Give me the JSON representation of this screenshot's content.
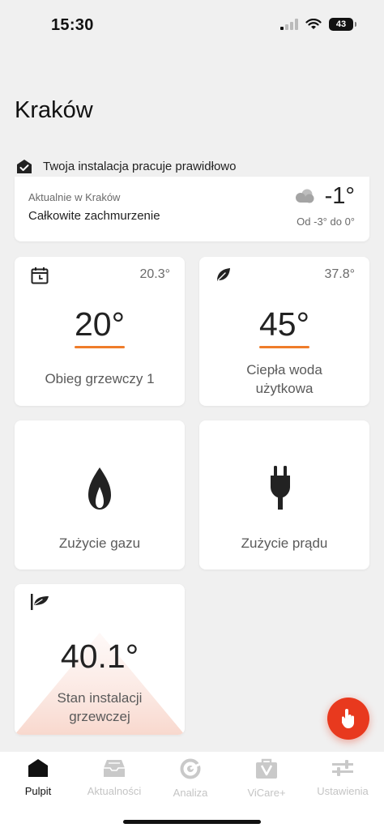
{
  "status_bar": {
    "time": "15:30",
    "battery": "43"
  },
  "header": {
    "title": "Kraków",
    "status_message": "Twoja instalacja pracuje prawidłowo"
  },
  "weather": {
    "location_label": "Aktualnie w Kraków",
    "description": "Całkowite zachmurzenie",
    "temperature": "-1°",
    "range": "Od -3° do 0°"
  },
  "tiles": {
    "heating": {
      "current": "20.3°",
      "setpoint": "20°",
      "label": "Obieg grzewczy 1"
    },
    "hot_water": {
      "current": "37.8°",
      "setpoint": "45°",
      "label_line1": "Ciepła woda",
      "label_line2": "użytkowa"
    },
    "gas": {
      "label": "Zużycie gazu"
    },
    "power": {
      "label": "Zużycie prądu"
    },
    "system": {
      "value": "40.1°",
      "label_line1": "Stan instalacji",
      "label_line2": "grzewczej"
    }
  },
  "tabs": [
    {
      "label": "Pulpit",
      "active": true
    },
    {
      "label": "Aktualności",
      "active": false
    },
    {
      "label": "Analiza",
      "active": false
    },
    {
      "label": "ViCare+",
      "active": false
    },
    {
      "label": "Ustawienia",
      "active": false
    }
  ],
  "colors": {
    "accent_orange": "#ef7c2a",
    "fab_red": "#e8391e",
    "background": "#f0f0f0",
    "inactive_tab": "#c4c4c4"
  },
  "icons": {
    "status": [
      "signal-icon",
      "wifi-icon",
      "battery-icon"
    ],
    "header": "house-check-icon",
    "weather": "cloud-icon",
    "heating": "calendar-icon",
    "hot_water": "leaf-icon",
    "gas": "flame-icon",
    "power": "plug-icon",
    "system": "flag-leaf-icon",
    "fab": "hand-tap-icon",
    "tabs": [
      "home-icon",
      "inbox-icon",
      "analysis-icon",
      "vicare-icon",
      "sliders-icon"
    ]
  }
}
